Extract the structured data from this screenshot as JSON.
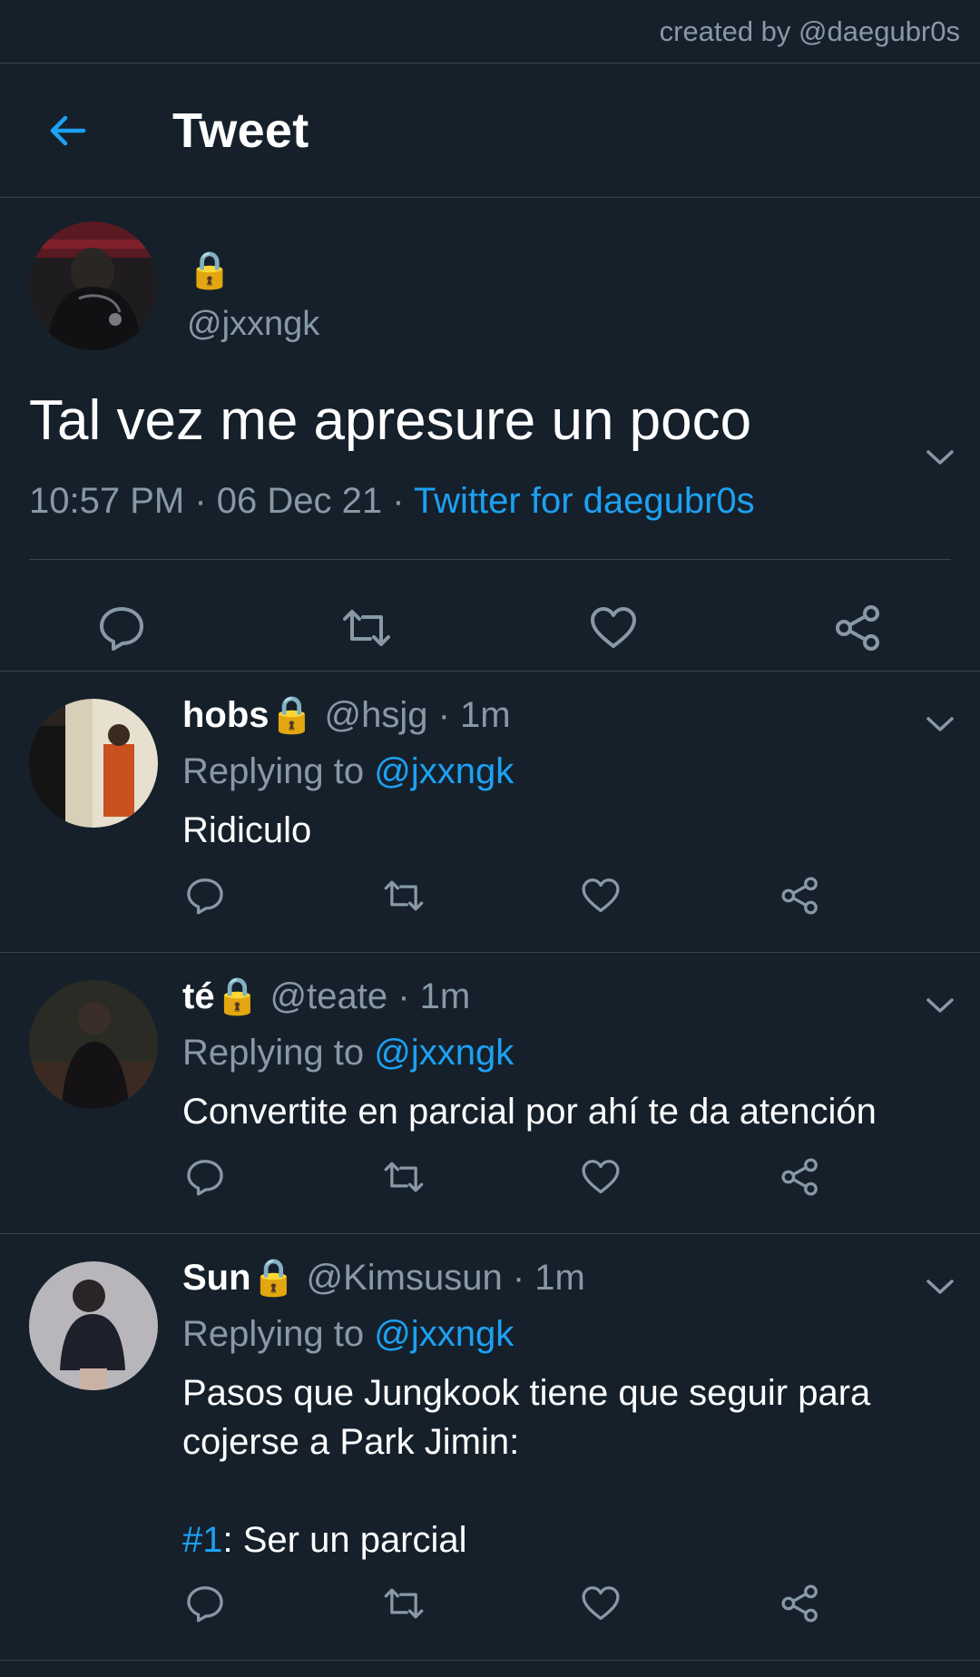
{
  "credit": "created by @daegubr0s",
  "header": {
    "title": "Tweet"
  },
  "main_tweet": {
    "lock": "🔒",
    "handle": "@jxxngk",
    "text": "Tal vez me apresure un poco",
    "time": "10:57 PM",
    "sep1": " · ",
    "date": "06 Dec 21",
    "sep2": " · ",
    "source": "Twitter for daegubr0s"
  },
  "replies": [
    {
      "name": "hobs",
      "lock": "🔒",
      "handle": "@hsjg",
      "sep": " · ",
      "time": "1m",
      "replying_prefix": "Replying to ",
      "replying_to": "@jxxngk",
      "text": "Ridiculo"
    },
    {
      "name": "té",
      "lock": "🔒",
      "handle": "@teate",
      "sep": " · ",
      "time": "1m",
      "replying_prefix": "Replying to ",
      "replying_to": "@jxxngk",
      "text": "Convertite en parcial por ahí te da atención"
    },
    {
      "name": "Sun",
      "lock": "🔒",
      "handle": "@Kimsusun",
      "sep": " · ",
      "time": "1m",
      "replying_prefix": "Replying to ",
      "replying_to": "@jxxngk",
      "text_line1": "Pasos que Jungkook tiene que seguir para",
      "text_line2": "cojerse a Park Jimin:",
      "hashtag": "#1",
      "text_line3": ": Ser un parcial"
    }
  ],
  "icons": {
    "back": "arrow-left-icon",
    "caret": "chevron-down-icon",
    "reply": "reply-icon",
    "retweet": "retweet-icon",
    "like": "heart-icon",
    "share": "share-icon"
  },
  "colors": {
    "background": "#15202b",
    "divider": "#38444d",
    "secondary_text": "#8899a6",
    "accent": "#1da1f2"
  }
}
